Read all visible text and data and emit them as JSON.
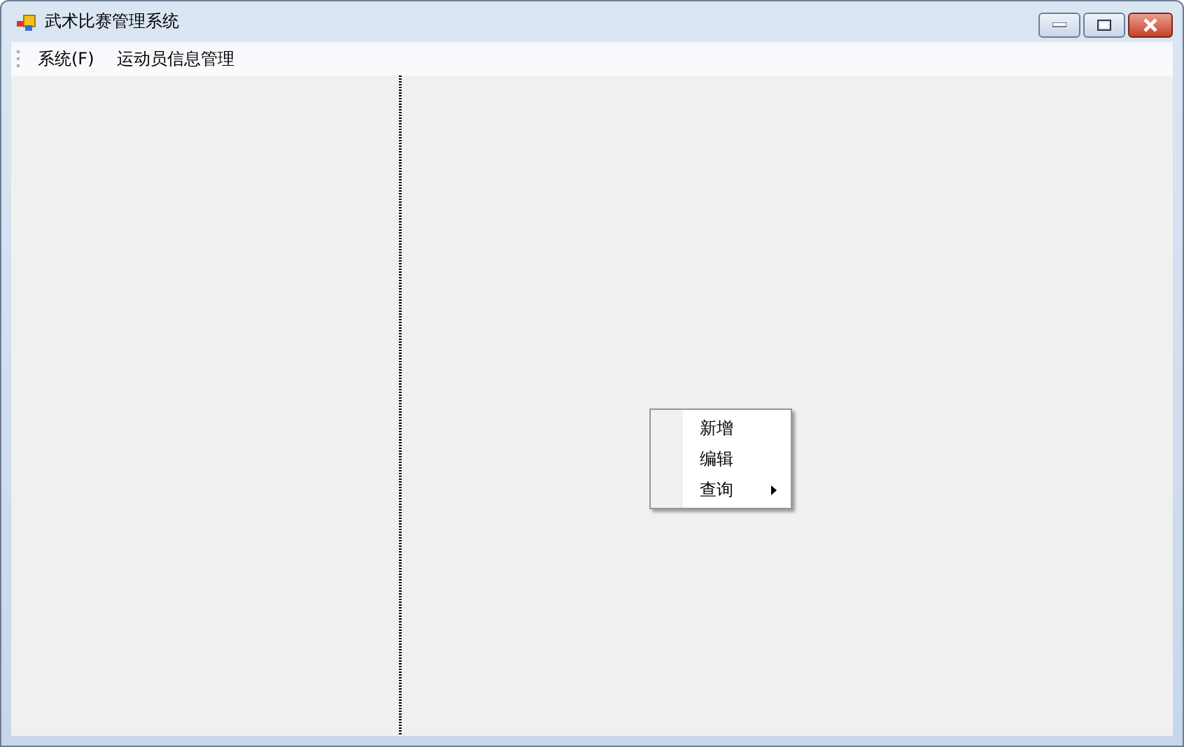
{
  "window": {
    "title": "武术比赛管理系统"
  },
  "menu": [
    {
      "label": "系统(F)"
    },
    {
      "label": "运动员信息管理"
    }
  ],
  "context_menu": [
    {
      "label": "新增",
      "has_submenu": false
    },
    {
      "label": "编辑",
      "has_submenu": false
    },
    {
      "label": "查询",
      "has_submenu": true
    }
  ]
}
